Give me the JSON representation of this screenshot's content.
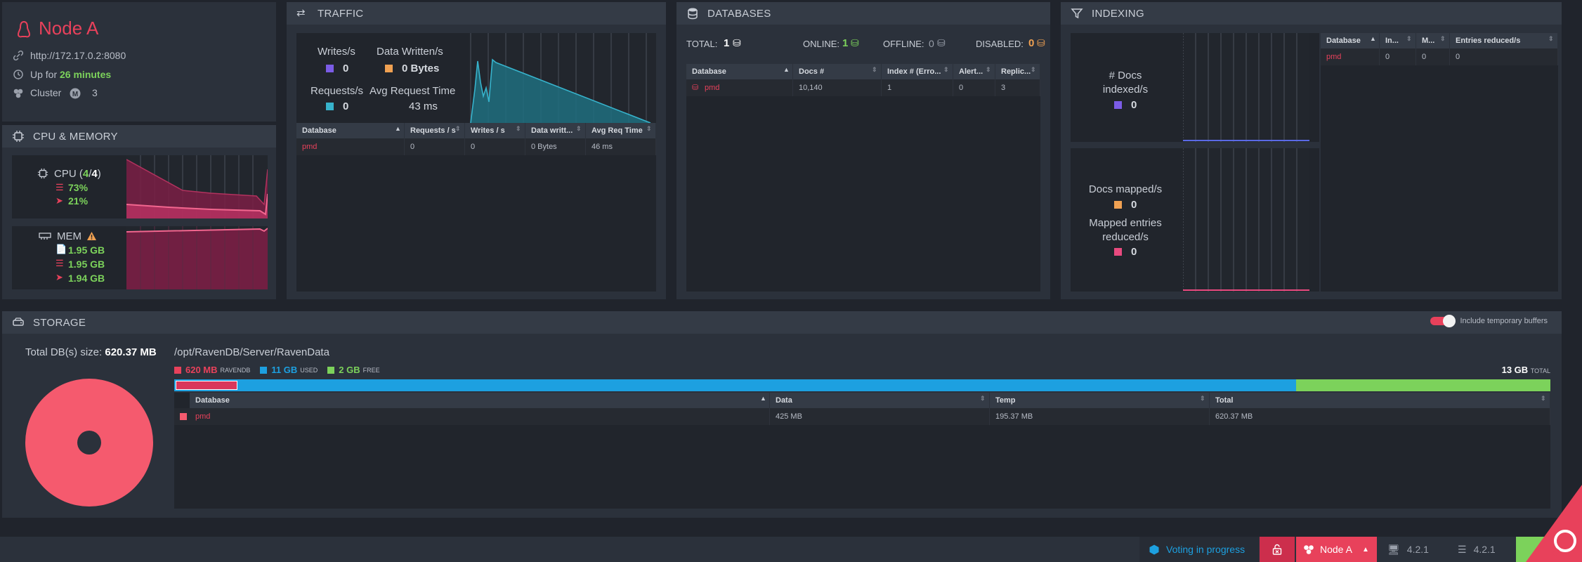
{
  "node": {
    "name": "Node A",
    "url": "http://172.17.0.2:8080",
    "uptime_prefix": "Up for",
    "uptime_value": "26 minutes",
    "cluster_label": "Cluster",
    "cluster_count": "3"
  },
  "cpu_memory": {
    "title": "CPU & MEMORY",
    "cpu_label": "CPU (",
    "cpu_used": "4",
    "cpu_sep": "/",
    "cpu_total": "4",
    "cpu_close": ")",
    "cpu_machine": "73%",
    "cpu_process": "21%",
    "mem_label": "MEM",
    "mem_total": "1.95 GB",
    "mem_machine": "1.95 GB",
    "mem_process": "1.94 GB"
  },
  "traffic": {
    "title": "TRAFFIC",
    "writes_label": "Writes/s",
    "writes_value": "0",
    "data_written_label": "Data Written/s",
    "data_written_value": "0 Bytes",
    "requests_label": "Requests/s",
    "requests_value": "0",
    "avg_label": "Avg Request Time",
    "avg_value": "43 ms",
    "columns": [
      "Database",
      "Requests / s",
      "Writes / s",
      "Data writt...",
      "Avg Req Time"
    ],
    "rows": [
      [
        "pmd",
        "0",
        "0",
        "0 Bytes",
        "46 ms"
      ]
    ]
  },
  "databases": {
    "title": "DATABASES",
    "total_label": "TOTAL:",
    "total_value": "1",
    "online_label": "ONLINE:",
    "online_value": "1",
    "offline_label": "OFFLINE:",
    "offline_value": "0",
    "disabled_label": "DISABLED:",
    "disabled_value": "0",
    "columns": [
      "Database",
      "Docs #",
      "Index # (Erro...",
      "Alert...",
      "Replic..."
    ],
    "rows": [
      [
        "pmd",
        "10,140",
        "1",
        "0",
        "3"
      ]
    ]
  },
  "indexing": {
    "title": "INDEXING",
    "docs_indexed_label_1": "# Docs",
    "docs_indexed_label_2": "indexed/s",
    "docs_indexed_value": "0",
    "docs_mapped_label": "Docs mapped/s",
    "docs_mapped_value": "0",
    "entries_reduced_label_1": "Mapped entries",
    "entries_reduced_label_2": "reduced/s",
    "entries_reduced_value": "0",
    "columns": [
      "Database",
      "In...",
      "M...",
      "Entries reduced/s"
    ],
    "rows": [
      [
        "pmd",
        "0",
        "0",
        "0"
      ]
    ]
  },
  "storage": {
    "title": "STORAGE",
    "toggle_label": "Include temporary buffers",
    "total_db_label": "Total DB(s) size:",
    "total_db_value": "620.37 MB",
    "path": "/opt/RavenDB/Server/RavenData",
    "ravendb_value": "620 MB",
    "ravendb_label": "RAVENDB",
    "used_value": "11 GB",
    "used_label": "USED",
    "free_value": "2 GB",
    "free_label": "FREE",
    "total_value": "13 GB",
    "total_label": "TOTAL",
    "ravendb_fraction": 0.045,
    "used_fraction": 0.815,
    "columns": [
      "Database",
      "Data",
      "Temp",
      "Total"
    ],
    "rows": [
      [
        "pmd",
        "425 MB",
        "195.37 MB",
        "620.37 MB"
      ]
    ]
  },
  "statusbar": {
    "voting": "Voting in progress",
    "node": "Node A",
    "version_client": "4.2.1",
    "version_server": "4.2.1"
  },
  "colors": {
    "accent_red": "#e8415b",
    "green": "#7cd25b",
    "orange": "#f0a152",
    "blue": "#1da0e0",
    "purple": "#7b5ce6",
    "teal": "#37b3cc",
    "pink": "#e84a7f"
  }
}
